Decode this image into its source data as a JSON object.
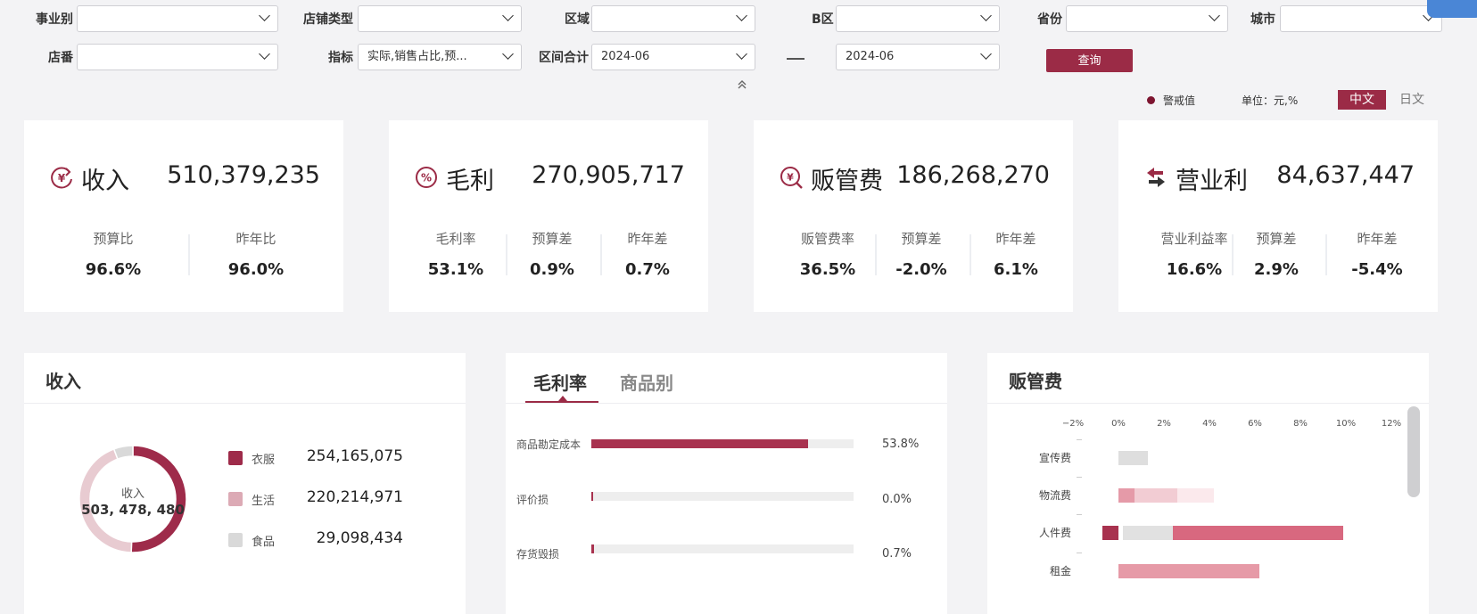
{
  "filters": {
    "business_label": "事业别",
    "store_type_label": "店铺类型",
    "region_label": "区域",
    "b_area_label": "B区",
    "province_label": "省份",
    "city_label": "城市",
    "store_no_label": "店番",
    "metric_label": "指标",
    "metric_value": "实际,销售占比,预...",
    "range_label": "区间合计",
    "range_start": "2024-06",
    "range_end": "2024-06",
    "query_label": "查询"
  },
  "legend_bar": {
    "warning_label": "警戒值",
    "unit_label": "单位：元,%",
    "lang_cn": "中文",
    "lang_jp": "日文"
  },
  "kpis": [
    {
      "icon": "yen-exchange-icon",
      "title": "收入",
      "value": "510,379,235",
      "subs": [
        {
          "label": "预算比",
          "value": "96.6%"
        },
        {
          "label": "昨年比",
          "value": "96.0%"
        }
      ]
    },
    {
      "icon": "percent-icon",
      "title": "毛利",
      "value": "270,905,717",
      "subs": [
        {
          "label": "毛利率",
          "value": "53.1%"
        },
        {
          "label": "预算差",
          "value": "0.9%"
        },
        {
          "label": "昨年差",
          "value": "0.7%"
        }
      ]
    },
    {
      "icon": "yen-search-icon",
      "title": "贩管费",
      "value": "186,268,270",
      "subs": [
        {
          "label": "贩管费率",
          "value": "36.5%"
        },
        {
          "label": "预算差",
          "value": "-2.0%"
        },
        {
          "label": "昨年差",
          "value": "6.1%"
        }
      ]
    },
    {
      "icon": "transfer-arrows-icon",
      "title": "营业利",
      "value": "84,637,447",
      "subs": [
        {
          "label": "营业利益率",
          "value": "16.6%"
        },
        {
          "label": "预算差",
          "value": "2.9%"
        },
        {
          "label": "昨年差",
          "value": "-5.4%"
        }
      ]
    }
  ],
  "revenue_panel": {
    "title": "收入",
    "center_label": "收入",
    "center_value": "503, 478, 480",
    "items": [
      {
        "name": "衣服",
        "value": "254,165,075"
      },
      {
        "name": "生活",
        "value": "220,214,971"
      },
      {
        "name": "食品",
        "value": "29,098,434"
      }
    ]
  },
  "margin_panel": {
    "tab_active": "毛利率",
    "tab_inactive": "商品别",
    "rows": [
      {
        "label": "商品勘定成本",
        "value_text": "53.8%"
      },
      {
        "label": "评价损",
        "value_text": "0.0%"
      },
      {
        "label": "存货毁损",
        "value_text": "0.7%"
      }
    ]
  },
  "expense_panel": {
    "title": "贩管费",
    "x_ticks": [
      "−2%",
      "0%",
      "2%",
      "4%",
      "6%",
      "8%",
      "10%",
      "12%"
    ],
    "categories": [
      "宣传费",
      "物流费",
      "人件费",
      "租金"
    ]
  },
  "chart_data": [
    {
      "type": "pie",
      "title": "收入",
      "categories": [
        "衣服",
        "生活",
        "食品"
      ],
      "values": [
        254165075,
        220214971,
        29098434
      ],
      "colors": [
        "#9e2b4a",
        "#e8cbd1",
        "#d9d9d9"
      ]
    },
    {
      "type": "bar",
      "orientation": "horizontal",
      "categories": [
        "商品勘定成本",
        "评价损",
        "存货毁损"
      ],
      "values": [
        53.8,
        0.0,
        0.7
      ],
      "ylim": [
        0,
        65
      ]
    },
    {
      "type": "bar",
      "orientation": "horizontal",
      "stacked": true,
      "categories": [
        "宣传费",
        "物流费",
        "人件费",
        "租金"
      ],
      "xlim": [
        -2,
        12
      ],
      "segments": [
        [
          {
            "start": 0,
            "end": 1.3,
            "color": "#dedede"
          }
        ],
        [
          {
            "start": 0,
            "end": 0.7,
            "color": "#e59aa8"
          },
          {
            "start": 0.7,
            "end": 2.6,
            "color": "#f2ccd3"
          },
          {
            "start": 2.6,
            "end": 4.2,
            "color": "#fbe9ec"
          }
        ],
        [
          {
            "start": -0.7,
            "end": 0,
            "color": "#a8324f"
          },
          {
            "start": 0.2,
            "end": 2.4,
            "color": "#e1e1e1"
          },
          {
            "start": 2.4,
            "end": 9.9,
            "color": "#d8687f"
          }
        ],
        [
          {
            "start": 0,
            "end": 6.2,
            "color": "#e69aa7"
          }
        ]
      ]
    }
  ]
}
